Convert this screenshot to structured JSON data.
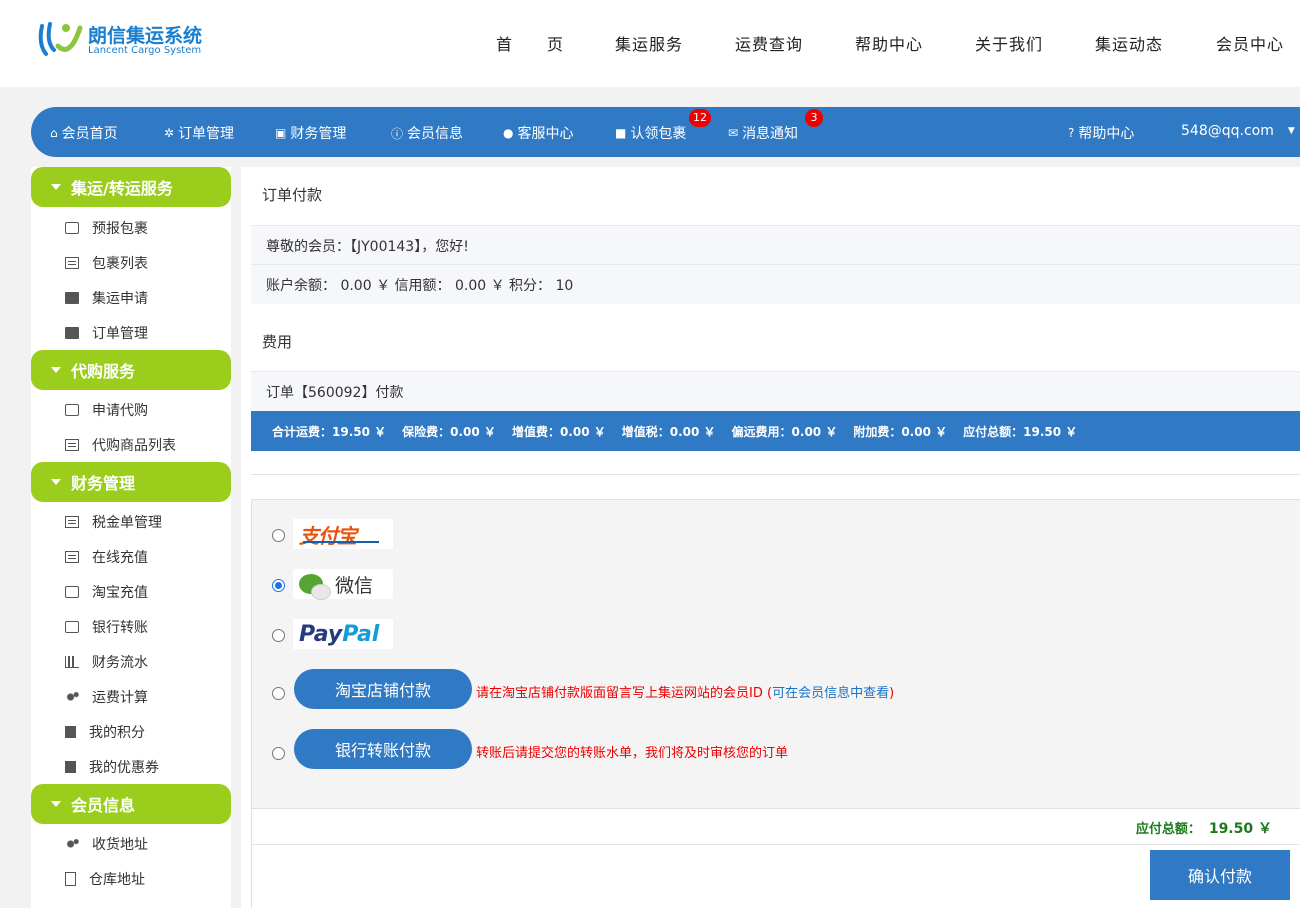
{
  "header": {
    "logo_title": "朗信集运系统",
    "logo_sub": "Lancent Cargo System",
    "nav": [
      "首　　页",
      "集运服务",
      "运费查询",
      "帮助中心",
      "关于我们",
      "集运动态",
      "会员中心"
    ]
  },
  "memberbar": {
    "items": [
      "会员首页",
      "订单管理",
      "财务管理",
      "会员信息",
      "客服中心",
      "认领包裹",
      "消息通知"
    ],
    "badges": {
      "claim": "12",
      "messages": "3"
    },
    "help": "帮助中心",
    "user": "548@qq.com"
  },
  "sidebar": {
    "sections": [
      {
        "title": "集运/转运服务",
        "items": [
          "预报包裹",
          "包裹列表",
          "集运申请",
          "订单管理"
        ]
      },
      {
        "title": "代购服务",
        "items": [
          "申请代购",
          "代购商品列表"
        ]
      },
      {
        "title": "财务管理",
        "items": [
          "税金单管理",
          "在线充值",
          "淘宝充值",
          "银行转账",
          "财务流水",
          "运费计算",
          "我的积分",
          "我的优惠券"
        ]
      },
      {
        "title": "会员信息",
        "items": [
          "收货地址",
          "仓库地址"
        ]
      }
    ]
  },
  "main": {
    "title": "订单付款",
    "greeting": "尊敬的会员：【JY00143】，您好!",
    "account": "账户余额：  0.00 ￥   信用额：  0.00 ￥   积分：  10",
    "fee_title": "费用",
    "order_line": "订单【560092】付款",
    "fees": [
      "合计运费：19.50 ￥",
      "保险费：0.00 ￥",
      "增值费：0.00 ￥",
      "增值税：0.00 ￥",
      "偏远费用：0.00 ￥",
      "附加费：0.00 ￥",
      "应付总额：19.50 ￥"
    ],
    "payment": {
      "alipay_text": "支付宝",
      "wechat_text": "微信",
      "paypal_a": "Pay",
      "paypal_b": "Pal",
      "selected": "wechat",
      "taobao_btn": "淘宝店铺付款",
      "taobao_note": "请在淘宝店铺付款版面留言写上集运网站的会员ID (",
      "taobao_link": "可在会员信息中查看",
      "taobao_note_end": ")",
      "bank_btn": "银行转账付款",
      "bank_note": "转账后请提交您的转账水单，我们将及时审核您的订单"
    },
    "total_label": "应付总额：",
    "total_value": "19.50 ￥",
    "confirm": "确认付款"
  }
}
